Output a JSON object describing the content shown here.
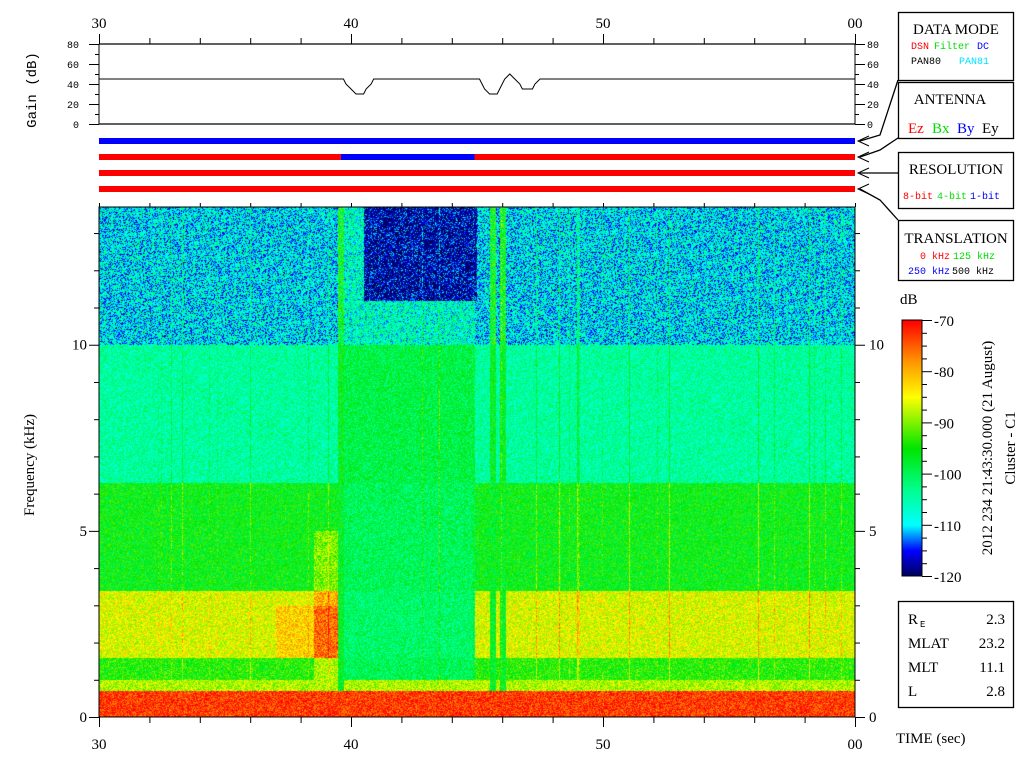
{
  "chart_data": {
    "type": "heatmap",
    "title": "2012 234 21:43:30.000 (21 August)",
    "subtitle": "Cluster - C1",
    "xlabel": "TIME (sec)",
    "ylabel": "Frequency (kHz)",
    "x_ticks": [
      "30",
      "40",
      "50",
      "00"
    ],
    "x_range": [
      30,
      60
    ],
    "y_ticks": [
      "0",
      "5",
      "10"
    ],
    "y_range": [
      0,
      13.7
    ],
    "colorbar": {
      "label": "dB",
      "range": [
        -120,
        -70
      ],
      "ticks": [
        "-70",
        "-80",
        "-90",
        "-100",
        "-110",
        "-120"
      ]
    },
    "gain": {
      "ylabel": "Gain (dB)",
      "y_ticks": [
        "0",
        "20",
        "40",
        "60",
        "80"
      ],
      "y_range": [
        0,
        80
      ],
      "points": [
        [
          30,
          45
        ],
        [
          39.7,
          45
        ],
        [
          39.8,
          40
        ],
        [
          40.0,
          35
        ],
        [
          40.2,
          30
        ],
        [
          40.5,
          30
        ],
        [
          40.6,
          35
        ],
        [
          40.8,
          40
        ],
        [
          40.9,
          45
        ],
        [
          45.1,
          45
        ],
        [
          45.2,
          40
        ],
        [
          45.3,
          35
        ],
        [
          45.5,
          30
        ],
        [
          45.8,
          30
        ],
        [
          45.9,
          35
        ],
        [
          46.1,
          45
        ],
        [
          46.3,
          50
        ],
        [
          46.5,
          45
        ],
        [
          46.7,
          40
        ],
        [
          46.8,
          35
        ],
        [
          47.2,
          35
        ],
        [
          47.3,
          40
        ],
        [
          47.5,
          45
        ],
        [
          60,
          45
        ]
      ]
    },
    "status_bars": [
      {
        "panel": "data_mode",
        "segments": [
          {
            "from": 30,
            "to": 60,
            "color": "#0000ff"
          }
        ]
      },
      {
        "panel": "antenna",
        "segments": [
          {
            "from": 30,
            "to": 39.6,
            "color": "#ff0000"
          },
          {
            "from": 39.6,
            "to": 44.9,
            "color": "#0000ff"
          },
          {
            "from": 44.9,
            "to": 60,
            "color": "#ff0000"
          }
        ]
      },
      {
        "panel": "resolution",
        "segments": [
          {
            "from": 30,
            "to": 60,
            "color": "#ff0000"
          }
        ]
      },
      {
        "panel": "translation",
        "segments": [
          {
            "from": 30,
            "to": 60,
            "color": "#ff0000"
          }
        ]
      }
    ],
    "features": {
      "gap_interval_sec": [
        39.7,
        44.9
      ],
      "quiet_top_region": {
        "t": [
          40.5,
          45
        ],
        "f_min_khz": 11.2
      },
      "stripes_sec": [
        39.6,
        45.6,
        46.0
      ]
    }
  },
  "panels": {
    "data_mode": {
      "title": "DATA MODE",
      "items": [
        {
          "label": "DSN",
          "color": "#ff0000"
        },
        {
          "label": "Filter",
          "color": "#00dd00"
        },
        {
          "label": "DC",
          "color": "#0000ff"
        },
        {
          "label": "PAN80",
          "color": "#000000"
        },
        {
          "label": "PAN81",
          "color": "#00e5ff"
        }
      ]
    },
    "antenna": {
      "title": "ANTENNA",
      "items": [
        {
          "label": "Ez",
          "color": "#ff0000"
        },
        {
          "label": "Bx",
          "color": "#00dd00"
        },
        {
          "label": "By",
          "color": "#0000ff"
        },
        {
          "label": "Ey",
          "color": "#000000"
        }
      ]
    },
    "resolution": {
      "title": "RESOLUTION",
      "items": [
        {
          "label": "8-bit",
          "color": "#ff0000"
        },
        {
          "label": "4-bit",
          "color": "#00dd00"
        },
        {
          "label": "1-bit",
          "color": "#0000ff"
        }
      ]
    },
    "translation": {
      "title": "TRANSLATION",
      "items": [
        {
          "label": "0 kHz",
          "color": "#ff0000"
        },
        {
          "label": "125 kHz",
          "color": "#00dd00"
        },
        {
          "label": "250 kHz",
          "color": "#0000ff"
        },
        {
          "label": "500 kHz",
          "color": "#000000"
        }
      ]
    }
  },
  "ephemeris": [
    {
      "label": "R",
      "sub": "E",
      "value": "2.3"
    },
    {
      "label": "MLAT",
      "sub": "",
      "value": "23.2"
    },
    {
      "label": "MLT",
      "sub": "",
      "value": "11.1"
    },
    {
      "label": "L",
      "sub": "",
      "value": "2.8"
    }
  ]
}
